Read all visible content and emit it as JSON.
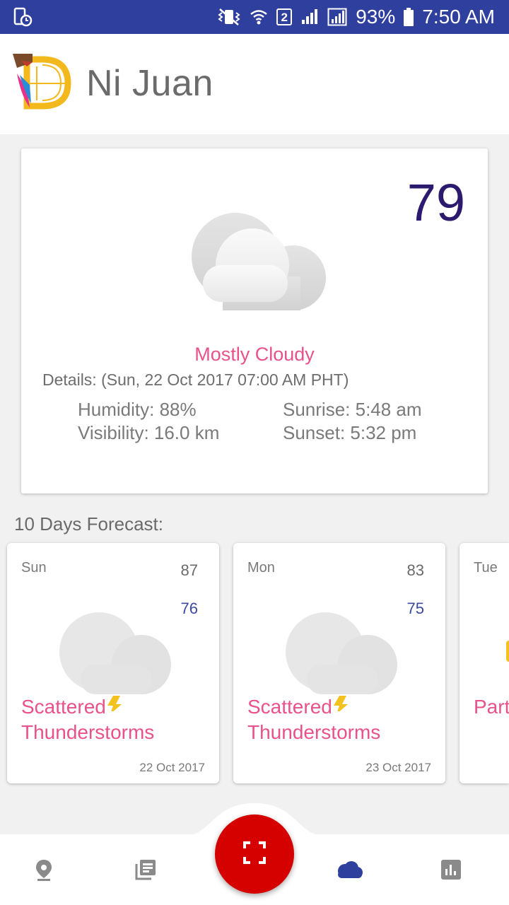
{
  "status_bar": {
    "battery_percent": "93%",
    "time": "7:50 AM",
    "sim_slot": "2"
  },
  "header": {
    "title": "Ni Juan"
  },
  "current": {
    "temperature": "79",
    "condition": "Mostly Cloudy",
    "details": "Details: (Sun, 22 Oct 2017 07:00 AM PHT)",
    "humidity": "Humidity: 88%",
    "visibility": "Visibility: 16.0 km",
    "sunrise": "Sunrise: 5:48 am",
    "sunset": "Sunset: 5:32 pm",
    "icon": "mostly-cloudy-icon"
  },
  "forecast": {
    "heading": "10 Days Forecast:",
    "days": [
      {
        "day": "Sun",
        "high": "87",
        "low": "76",
        "condition_line1": "Scattered",
        "condition_line2": "Thunderstorms",
        "date": "22 Oct 2017",
        "icon": "thunderstorm-icon"
      },
      {
        "day": "Mon",
        "high": "83",
        "low": "75",
        "condition_line1": "Scattered",
        "condition_line2": "Thunderstorms",
        "date": "23 Oct 2017",
        "icon": "thunderstorm-icon"
      },
      {
        "day": "Tue",
        "condition_line1": "",
        "condition_line2": "Part",
        "icon": "partly-cloudy-icon"
      }
    ]
  },
  "bottom_nav": {
    "items": [
      "location-icon",
      "news-icon",
      "scan-icon",
      "weather-icon",
      "stats-icon"
    ],
    "active": "weather-icon"
  },
  "colors": {
    "status_bar": "#2f3f9e",
    "condition_pink": "#e8528b",
    "temperature": "#2c1a6f",
    "low_temp": "#3b4aa0",
    "fab": "#d50000",
    "nav_active": "#2f3f9e",
    "nav_inactive": "#8a8a8a"
  }
}
